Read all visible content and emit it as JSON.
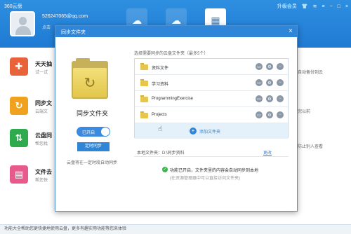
{
  "app": {
    "title": "360云盘",
    "top_right": {
      "upgrade": "升级会员",
      "icons": [
        "shirt-icon",
        "wifi-icon",
        "menu-icon",
        "minimize-icon",
        "maximize-icon",
        "close-icon"
      ]
    },
    "user": {
      "email": "526247065@qq.com",
      "sub": "点击"
    },
    "features": [
      {
        "name": "天天抽",
        "desc": "试一试",
        "color": "#e8623a"
      },
      {
        "name": "同步文",
        "desc": "云端文",
        "color": "#f0a21f"
      },
      {
        "name": "云盘同",
        "desc": "帮您找",
        "color": "#2faa4e"
      },
      {
        "name": "文件去",
        "desc": "帮您快",
        "color": "#e95a8c"
      }
    ],
    "side_notes": [
      "",
      "自动备份到云",
      "",
      "",
      "完以前",
      "",
      "",
      "防止别人查看"
    ],
    "bottom_text": "功能大全帮助您更快捷地使用云盘，更多有趣实用功能等您来体验"
  },
  "modal": {
    "title": "同步文件夹",
    "close": "×",
    "left": {
      "label": "同步文件夹",
      "toggle_label": "已开启",
      "timer_button": "定时同步",
      "timer_desc": "云盘将在一定时段自动同步"
    },
    "list_header": "选择需要同步的云盘文件夹（最多5个）",
    "folders": [
      {
        "name": "资料文件"
      },
      {
        "name": "学习资料"
      },
      {
        "name": "ProgrammingExercise"
      },
      {
        "name": "Projects"
      }
    ],
    "add_label": "添加文件夹",
    "local_path": "本地文件夹：D:\\同步资料",
    "change_link": "更改",
    "status_text": "功能已开启，文件夹里的内容会自动同步到本地",
    "status_sub": "(在资源管理器中可以直接访问文件夹)"
  }
}
